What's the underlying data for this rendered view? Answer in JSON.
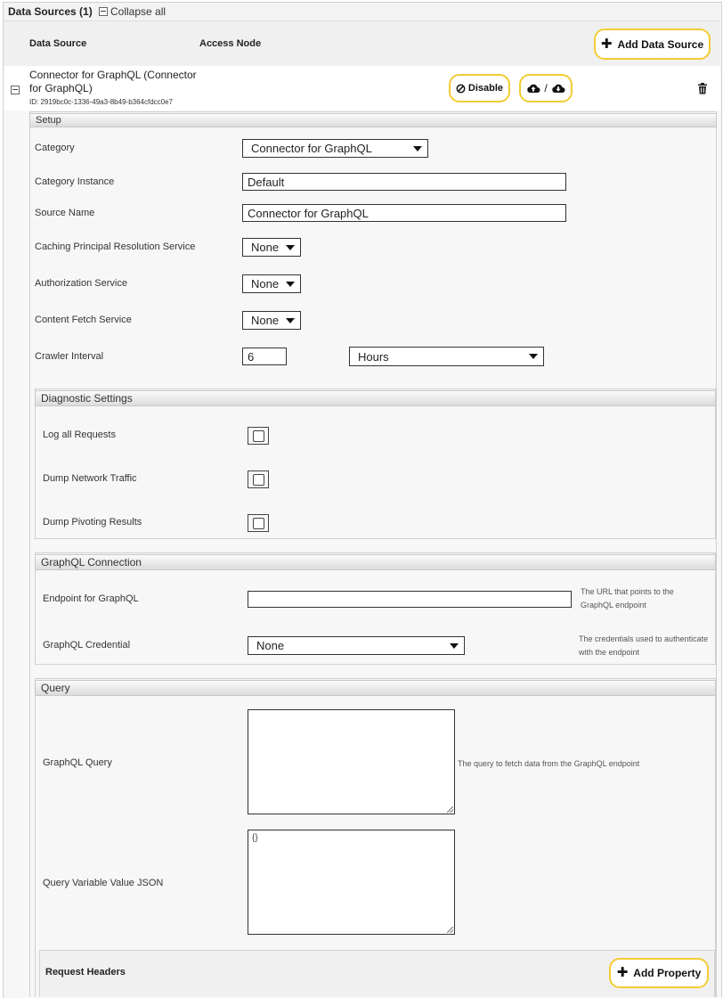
{
  "header": {
    "title": "Data Sources (1)",
    "collapse_all": "Collapse all",
    "col_data_source": "Data Source",
    "col_access_node": "Access Node",
    "add_data_source": "Add Data Source"
  },
  "data_source": {
    "name": "Connector for GraphQL (Connector for GraphQL)",
    "id": "ID: 2919bc0c-1336-49a3-8b49-b364cfdcc0e7",
    "disable": "Disable",
    "upload_download_sep": "/"
  },
  "setup": {
    "title": "Setup",
    "category_label": "Category",
    "category_value": "Connector for GraphQL",
    "category_instance_label": "Category Instance",
    "category_instance_value": "Default",
    "source_name_label": "Source Name",
    "source_name_value": "Connector for GraphQL",
    "caching_label": "Caching Principal Resolution Service",
    "caching_value": "None",
    "authorization_label": "Authorization Service",
    "authorization_value": "None",
    "content_fetch_label": "Content Fetch Service",
    "content_fetch_value": "None",
    "crawler_label": "Crawler Interval",
    "crawler_value": "6",
    "crawler_unit": "Hours"
  },
  "diagnostic": {
    "title": "Diagnostic Settings",
    "log_requests": "Log all Requests",
    "dump_network": "Dump Network Traffic",
    "dump_pivoting": "Dump Pivoting Results"
  },
  "graphql_connection": {
    "title": "GraphQL Connection",
    "endpoint_label": "Endpoint for GraphQL",
    "endpoint_value": "",
    "endpoint_help": "The URL that points to the GraphQL endpoint",
    "credential_label": "GraphQL Credential",
    "credential_value": "None",
    "credential_help": "The credentials used to authenticate with the endpoint"
  },
  "query": {
    "title": "Query",
    "graphql_query_label": "GraphQL Query",
    "graphql_query_value": "",
    "graphql_query_help": "The query to fetch data from the GraphQL endpoint",
    "variable_label": "Query Variable Value JSON",
    "variable_value": "{}",
    "request_headers": "Request Headers",
    "add_property": "Add Property"
  }
}
